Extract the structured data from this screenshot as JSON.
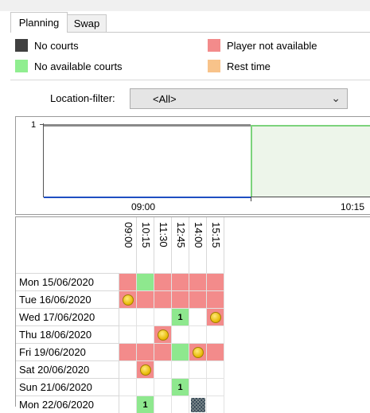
{
  "tabs": [
    {
      "label": "Planning",
      "active": true
    },
    {
      "label": "Swap",
      "active": false
    }
  ],
  "legend": {
    "no_courts": {
      "label": "No courts",
      "color": "#404040"
    },
    "no_available_courts": {
      "label": "No available courts",
      "color": "#90ee90"
    },
    "player_not_available": {
      "label": "Player not available",
      "color": "#f38b8b"
    },
    "rest_time": {
      "label": "Rest time",
      "color": "#f8c38a"
    }
  },
  "filter": {
    "label": "Location-filter:",
    "value": "<All>"
  },
  "timeline": {
    "y_label": "1",
    "x_labels": [
      "09:00",
      "10:15"
    ]
  },
  "columns": [
    "09:00",
    "10:15",
    "11:30",
    "12:45",
    "14:00",
    "15:15"
  ],
  "rows": [
    {
      "date": "Mon 15/06/2020",
      "cells": [
        "na",
        "free",
        "na",
        "na",
        "na",
        "na"
      ]
    },
    {
      "date": "Tue 16/06/2020",
      "cells": [
        "na coin",
        "na",
        "na",
        "na",
        "na",
        "na"
      ]
    },
    {
      "date": "Wed 17/06/2020",
      "cells": [
        "white",
        "white",
        "white",
        "free 1",
        "white",
        "na coin"
      ]
    },
    {
      "date": "Thu 18/06/2020",
      "cells": [
        "white",
        "white",
        "na coin",
        "white",
        "white",
        "white"
      ]
    },
    {
      "date": "Fri 19/06/2020",
      "cells": [
        "na",
        "na",
        "na",
        "free",
        "na coin",
        "na"
      ]
    },
    {
      "date": "Sat 20/06/2020",
      "cells": [
        "white",
        "na coin",
        "white",
        "white",
        "white",
        "white"
      ]
    },
    {
      "date": "Sun 21/06/2020",
      "cells": [
        "white",
        "white",
        "white",
        "free 1",
        "white",
        "white"
      ]
    },
    {
      "date": "Mon 22/06/2020",
      "cells": [
        "white",
        "free 1",
        "white",
        "white",
        "hatch",
        "white"
      ]
    }
  ]
}
